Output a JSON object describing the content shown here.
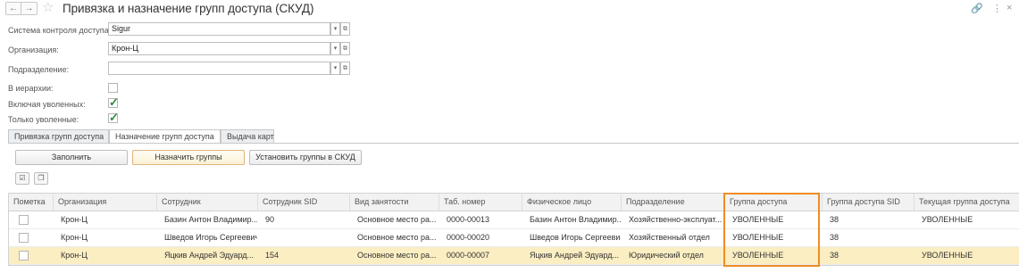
{
  "window": {
    "title": "Привязка и назначение групп доступа (СКУД)",
    "back_icon": "←",
    "forward_icon": "→",
    "link_icon": "🔗",
    "more_icon": "⋮",
    "close_icon": "×"
  },
  "form": {
    "system_label": "Система контроля доступа:",
    "system_value": "Sigur",
    "org_label": "Организация:",
    "org_value": "Крон-Ц",
    "dept_label": "Подразделение:",
    "dept_value": "",
    "hierarchy_label": "В иерархии:",
    "hierarchy_checked": false,
    "include_fired_label": "Включая уволенных:",
    "include_fired_checked": true,
    "only_fired_label": "Только уволенные:",
    "only_fired_checked": true
  },
  "tabs": [
    "Привязка групп доступа",
    "Назначение групп доступа",
    "Выдача карт"
  ],
  "active_tab": 1,
  "toolbar": {
    "fill_label": "Заполнить",
    "assign_label": "Назначить группы",
    "set_label": "Установить группы в СКУД"
  },
  "table": {
    "columns": [
      "Пометка",
      "Организация",
      "Сотрудник",
      "Сотрудник SID",
      "Вид занятости",
      "Таб. номер",
      "Физическое лицо",
      "Подразделение",
      "Группа доступа",
      "Группа доступа SID",
      "Текущая группа доступа"
    ],
    "rows": [
      {
        "mark": false,
        "org": "Крон-Ц",
        "employee": "Базин Антон Владимир...",
        "sid": "90",
        "employment": "Основное место ра...",
        "tab": "0000-00013",
        "person": "Базин Антон Владимир...",
        "dept": "Хозяйственно-эксплуат...",
        "group": "УВОЛЕННЫЕ",
        "group_sid": "38",
        "current": "УВОЛЕННЫЕ"
      },
      {
        "mark": false,
        "org": "Крон-Ц",
        "employee": "Шведов Игорь Сергеевич",
        "sid": "",
        "employment": "Основное место ра...",
        "tab": "0000-00020",
        "person": "Шведов Игорь Сергеевич",
        "dept": "Хозяйственный отдел",
        "group": "УВОЛЕННЫЕ",
        "group_sid": "38",
        "current": ""
      },
      {
        "mark": false,
        "org": "Крон-Ц",
        "employee": "Яцкив Андрей Эдуард...",
        "sid": "154",
        "employment": "Основное место ра...",
        "tab": "0000-00007",
        "person": "Яцкив Андрей Эдуард...",
        "dept": "Юридический отдел",
        "group": "УВОЛЕННЫЕ",
        "group_sid": "38",
        "current": "УВОЛЕННЫЕ"
      }
    ],
    "selected_row": 2
  },
  "colors": {
    "highlight_border": "#f08c24",
    "selected_row": "#fbeec2",
    "check_green": "#2e8b3a"
  }
}
